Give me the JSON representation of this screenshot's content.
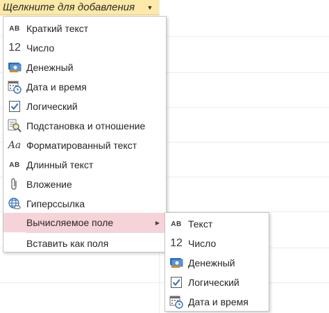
{
  "header": {
    "text": "Щелкните для добавления"
  },
  "menu": {
    "items": [
      {
        "icon": "short-text-icon",
        "glyph": "AB",
        "label": "Краткий текст"
      },
      {
        "icon": "number-icon",
        "glyph": "12",
        "label": "Число"
      },
      {
        "icon": "currency-icon",
        "label": "Денежный"
      },
      {
        "icon": "date-time-icon",
        "label": "Дата и время"
      },
      {
        "icon": "checkbox-icon",
        "label": "Логический"
      },
      {
        "icon": "lookup-icon",
        "label": "Подстановка и отношение"
      },
      {
        "icon": "rich-text-icon",
        "glyph": "Aa",
        "label": "Форматированный текст"
      },
      {
        "icon": "long-text-icon",
        "glyph": "AB",
        "label": "Длинный текст"
      },
      {
        "icon": "attachment-icon",
        "label": "Вложение"
      },
      {
        "icon": "hyperlink-icon",
        "label": "Гиперссылка"
      },
      {
        "label": "Вычисляемое поле"
      },
      {
        "label": "Вставить как поля"
      }
    ]
  },
  "submenu": {
    "items": [
      {
        "icon": "text-icon",
        "glyph": "AB",
        "label": "Текст"
      },
      {
        "icon": "number-icon",
        "glyph": "12",
        "label": "Число"
      },
      {
        "icon": "currency-icon",
        "label": "Денежный"
      },
      {
        "icon": "checkbox-icon",
        "label": "Логический"
      },
      {
        "icon": "date-time-icon",
        "label": "Дата и время"
      }
    ]
  },
  "colors": {
    "header_bg": "#fde9a8",
    "highlight": "#f6d3d8",
    "accent_blue": "#2e6db4"
  }
}
